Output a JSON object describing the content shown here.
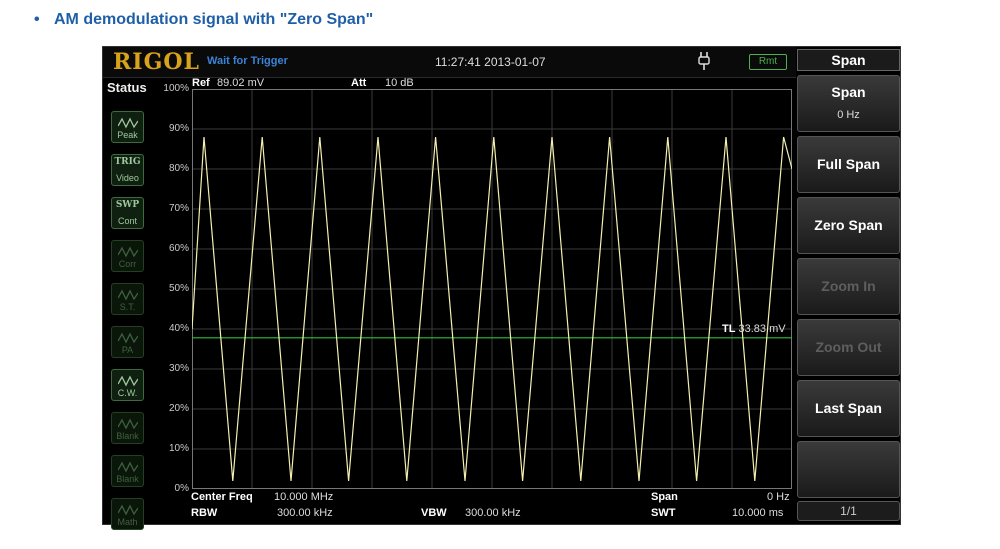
{
  "caption": {
    "bullet": "•",
    "text": "AM demodulation signal with \"Zero Span\""
  },
  "topbar": {
    "logo": "RIGOL",
    "trigger_status": "Wait for Trigger",
    "datetime": "11:27:41 2013-01-07",
    "remote_badge": "Rmt",
    "power_icon": "plug-icon"
  },
  "status": {
    "title": "Status",
    "buttons": [
      {
        "top": "",
        "label": "Peak",
        "icon": "peak-icon",
        "active": true
      },
      {
        "top": "TRIG",
        "label": "Video",
        "icon": "",
        "active": true
      },
      {
        "top": "SWP",
        "label": "Cont",
        "icon": "",
        "active": true
      },
      {
        "top": "",
        "label": "Corr",
        "icon": "corr-icon",
        "active": false
      },
      {
        "top": "",
        "label": "S.T.",
        "icon": "st-icon",
        "active": false
      },
      {
        "top": "",
        "label": "PA",
        "icon": "pa-icon",
        "active": false
      },
      {
        "top": "",
        "label": "C.W.",
        "icon": "cw-icon",
        "active": true
      },
      {
        "top": "",
        "label": "Blank",
        "icon": "blank-icon",
        "active": false
      },
      {
        "top": "",
        "label": "Blank",
        "icon": "blank-icon",
        "active": false
      },
      {
        "top": "",
        "label": "Math",
        "icon": "math-icon",
        "active": false
      }
    ]
  },
  "header": {
    "ref_label": "Ref",
    "ref_value": "89.02 mV",
    "att_label": "Att",
    "att_value": "10 dB"
  },
  "trace": {
    "color": "#f4f0b0",
    "line_color": "#2fbf3a",
    "tl_label": "TL",
    "tl_value": "33.83 mV"
  },
  "bottom": {
    "center_freq_label": "Center Freq",
    "center_freq_value": "10.000 MHz",
    "rbw_label": "RBW",
    "rbw_value": "300.00 kHz",
    "vbw_label": "VBW",
    "vbw_value": "300.00 kHz",
    "span_label": "Span",
    "span_value": "0 Hz",
    "swt_label": "SWT",
    "swt_value": "10.000 ms"
  },
  "menu": {
    "title": "Span",
    "buttons": [
      {
        "label": "Span",
        "value": "0 Hz",
        "enabled": true
      },
      {
        "label": "Full Span",
        "value": "",
        "enabled": true
      },
      {
        "label": "Zero Span",
        "value": "",
        "enabled": true
      },
      {
        "label": "Zoom In",
        "value": "",
        "enabled": false
      },
      {
        "label": "Zoom Out",
        "value": "",
        "enabled": false
      },
      {
        "label": "Last Span",
        "value": "",
        "enabled": true
      },
      {
        "label": "",
        "value": "",
        "enabled": false
      }
    ],
    "page": "1/1"
  },
  "chart_data": {
    "type": "line",
    "ylabel_ticks": [
      "100%",
      "90%",
      "80%",
      "70%",
      "60%",
      "50%",
      "40%",
      "30%",
      "20%",
      "10%",
      "0%"
    ],
    "ylim": [
      0,
      100
    ],
    "xlim": [
      0,
      10
    ],
    "x_unit": "ms",
    "grid": true,
    "series": [
      {
        "x": [
          0,
          0.2,
          0.68,
          1.17,
          1.65,
          2.13,
          2.61,
          3.1,
          3.58,
          4.06,
          4.55,
          5.03,
          5.51,
          6.0,
          6.48,
          6.96,
          7.45,
          7.93,
          8.41,
          8.9,
          9.38,
          9.86,
          10.0
        ],
        "y": [
          40,
          88,
          2,
          88,
          2,
          88,
          2,
          88,
          2,
          88,
          2,
          88,
          2,
          88,
          2,
          88,
          2,
          88,
          2,
          88,
          2,
          88,
          80
        ]
      }
    ],
    "threshold_line": {
      "label": "TL",
      "value": 37.8
    }
  }
}
